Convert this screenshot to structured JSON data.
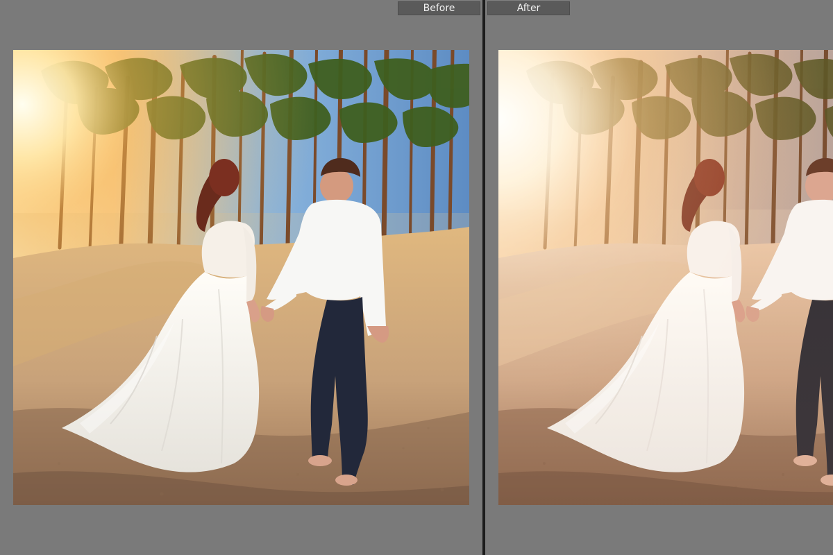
{
  "compare_view": {
    "before_label": "Before",
    "after_label": "After"
  },
  "colors": {
    "workspace_bg": "#7a7a7a",
    "label_bg": "#5a5a5a",
    "label_text": "#f1f1f1",
    "divider": "#1c1c1c"
  }
}
